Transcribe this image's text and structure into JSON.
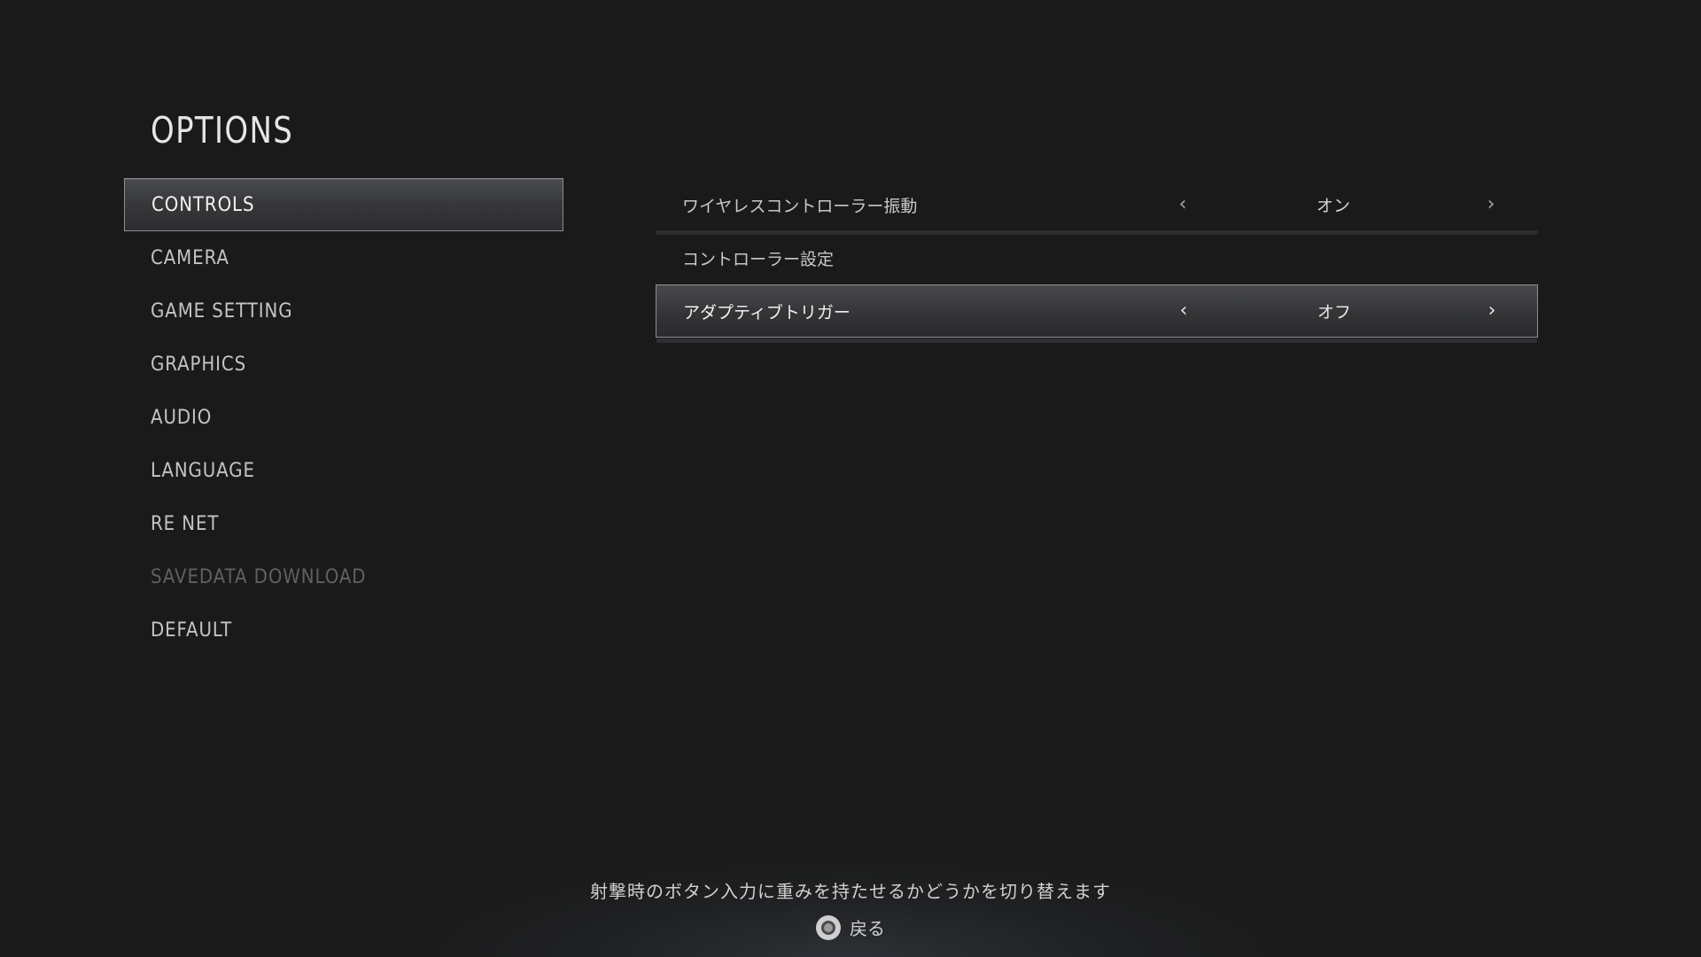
{
  "title": "OPTIONS",
  "menu": {
    "items": [
      {
        "label": "CONTROLS"
      },
      {
        "label": "CAMERA"
      },
      {
        "label": "GAME SETTING"
      },
      {
        "label": "GRAPHICS"
      },
      {
        "label": "AUDIO"
      },
      {
        "label": "LANGUAGE"
      },
      {
        "label": "RE NET"
      },
      {
        "label": "SAVEDATA DOWNLOAD"
      },
      {
        "label": "DEFAULT"
      }
    ],
    "active": "CONTROLS",
    "disabled": "SAVEDATA DOWNLOAD"
  },
  "settings": {
    "rows": [
      {
        "label": "ワイヤレスコントローラー振動",
        "value": "オン",
        "left_arrow": "‹",
        "right_arrow": "›"
      },
      {
        "label": "コントローラー設定"
      },
      {
        "label": "アダプティブトリガー",
        "value": "オフ",
        "left_arrow": "‹",
        "right_arrow": "›"
      }
    ],
    "active": "アダプティブトリガー"
  },
  "footer": {
    "hint": "射撃時のボタン入力に重みを持たせるかどうかを切り替えます",
    "back_label": "戻る",
    "back_icon": "circle-button-icon"
  },
  "colors": {
    "background": "#1a1a1a",
    "active_border": "#8b8d90",
    "disabled_text": "#5e6063"
  }
}
